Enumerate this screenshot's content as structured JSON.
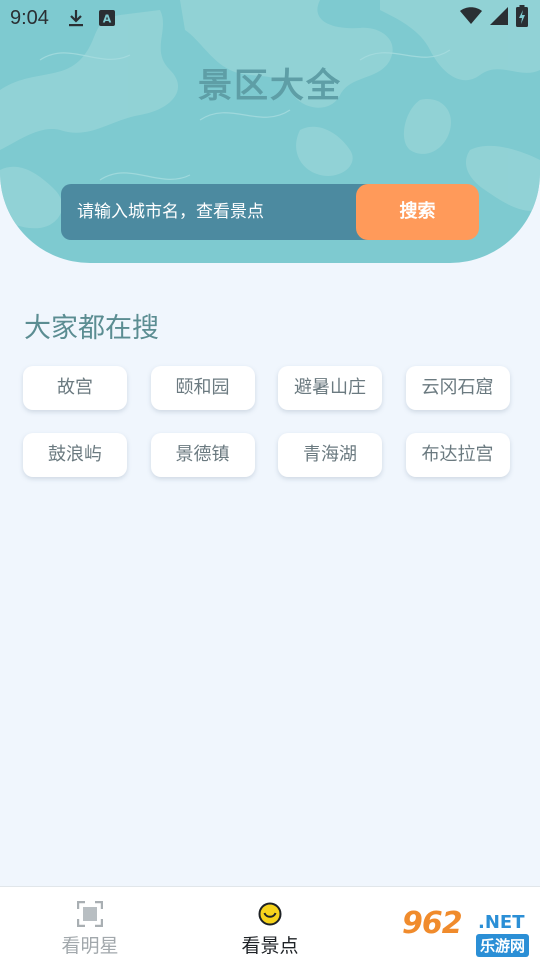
{
  "status_bar": {
    "time": "9:04",
    "icons": [
      "download-icon",
      "a-text-icon",
      "wifi-icon",
      "signal-icon",
      "battery-charging-icon"
    ]
  },
  "header": {
    "title": "景区大全"
  },
  "search": {
    "placeholder": "请输入城市名，查看景点",
    "button_label": "搜索"
  },
  "popular": {
    "title": "大家都在搜",
    "tags": [
      "故宫",
      "颐和园",
      "避暑山庄",
      "云冈石窟",
      "鼓浪屿",
      "景德镇",
      "青海湖",
      "布达拉宫"
    ]
  },
  "bottom_nav": {
    "items": [
      {
        "label": "看明星",
        "icon": "scan-frame-icon",
        "active": false
      },
      {
        "label": "看景点",
        "icon": "smiley-icon",
        "active": true
      }
    ]
  },
  "watermark": {
    "number": "962",
    "domain": ".NET",
    "site_name": "乐游网"
  },
  "colors": {
    "hero_bg": "#7ecad0",
    "search_bg": "#4c8aa0",
    "search_button": "#ff9a5a",
    "page_bg": "#f0f6fd",
    "title_text": "#5e9ea6"
  }
}
